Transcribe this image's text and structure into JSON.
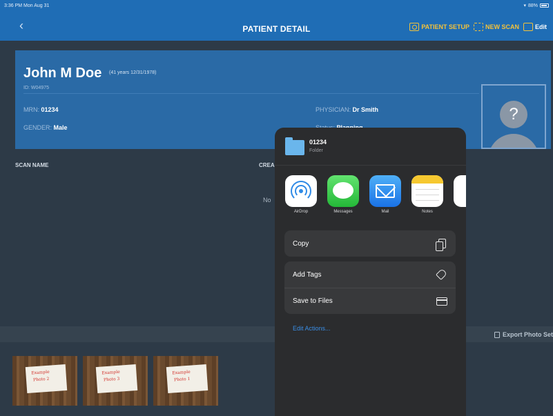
{
  "status_bar": {
    "time": "3:36 PM  Mon Aug 31",
    "battery": "88%"
  },
  "nav": {
    "title": "PATIENT DETAIL",
    "back_icon": "chevron-left-icon",
    "actions": [
      {
        "label": "PATIENT SETUP",
        "icon": "camera-icon"
      },
      {
        "label": "NEW SCAN",
        "icon": "scan-icon"
      },
      {
        "label": "Edit",
        "icon": "edit-icon"
      }
    ],
    "accent": "#f4c23a",
    "bar_color": "#1f6db5"
  },
  "patient": {
    "name": "John M Doe",
    "age": "(41 years 12/31/1978)",
    "id": "ID: W04975",
    "mrn_label": "MRN:",
    "mrn": "01234",
    "gender_label": "GENDER:",
    "gender": "Male",
    "physician_label": "PHYSICIAN:",
    "physician": "Dr Smith",
    "status_label": "Status:",
    "status": "Planning",
    "avatar_glyph": "?"
  },
  "table": {
    "col_scan_name": "SCAN NAME",
    "col_created": "CREA",
    "empty_text": "No"
  },
  "export": {
    "label": "Export Photo Set"
  },
  "photos": [
    {
      "line1": "Example",
      "line2": "Photo 2"
    },
    {
      "line1": "Example",
      "line2": "Photo 3"
    },
    {
      "line1": "Example",
      "line2": "Photo 1"
    }
  ],
  "share_sheet": {
    "title": "01234",
    "subtitle": "Folder",
    "apps": [
      {
        "label": "AirDrop",
        "icon": "airdrop-icon"
      },
      {
        "label": "Messages",
        "icon": "messages-icon"
      },
      {
        "label": "Mail",
        "icon": "mail-icon"
      },
      {
        "label": "Notes",
        "icon": "notes-icon"
      },
      {
        "label": "R",
        "icon": "more-app-icon"
      }
    ],
    "copy": "Copy",
    "add_tags": "Add Tags",
    "save_to_files": "Save to Files",
    "edit_actions": "Edit Actions..."
  }
}
